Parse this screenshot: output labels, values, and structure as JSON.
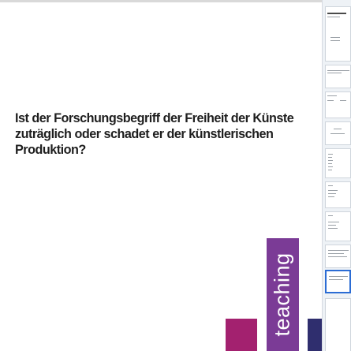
{
  "slide": {
    "question": "Ist der Forschungsbegriff der Freiheit der Künste zuträglich oder schadet er der künstlerischen Produktion?"
  },
  "brand": {
    "label": "teaching",
    "colors": {
      "magenta": "#a3216f",
      "purple": "#7b3b96",
      "navy": "#2f2e6e"
    }
  },
  "thumbnails": {
    "selected_index": 6
  }
}
